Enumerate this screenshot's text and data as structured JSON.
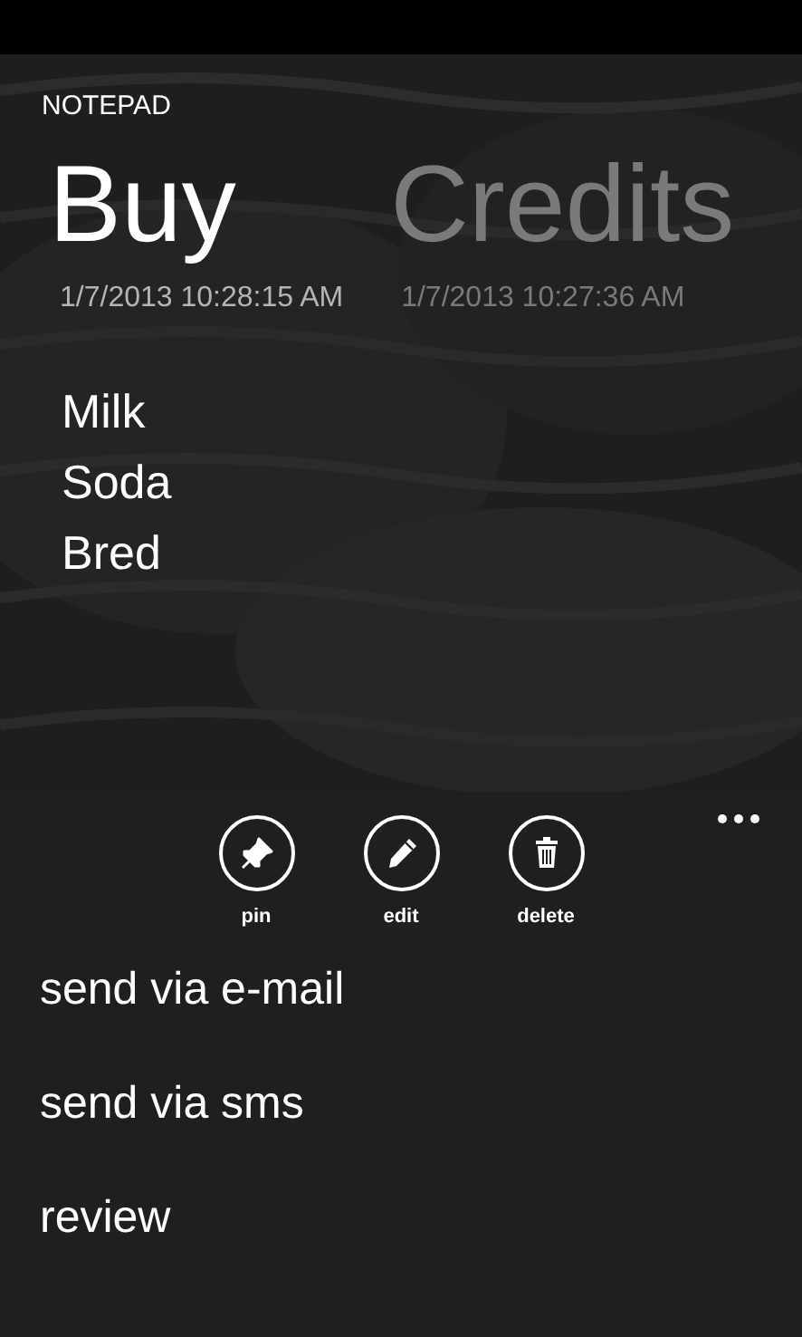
{
  "app_title": "NOTEPAD",
  "pivots": [
    {
      "title": "Buy",
      "date": "1/7/2013 10:28:15 AM",
      "selected": true
    },
    {
      "title": "Credits",
      "date": "1/7/2013 10:27:36 AM",
      "selected": false
    }
  ],
  "note_lines": [
    "Milk",
    "Soda",
    "Bred"
  ],
  "app_bar": {
    "buttons": [
      {
        "kind": "pin",
        "label": "pin"
      },
      {
        "kind": "edit",
        "label": "edit"
      },
      {
        "kind": "delete",
        "label": "delete"
      }
    ],
    "menu_items": [
      "send via e-mail",
      "send via sms",
      "review"
    ]
  }
}
